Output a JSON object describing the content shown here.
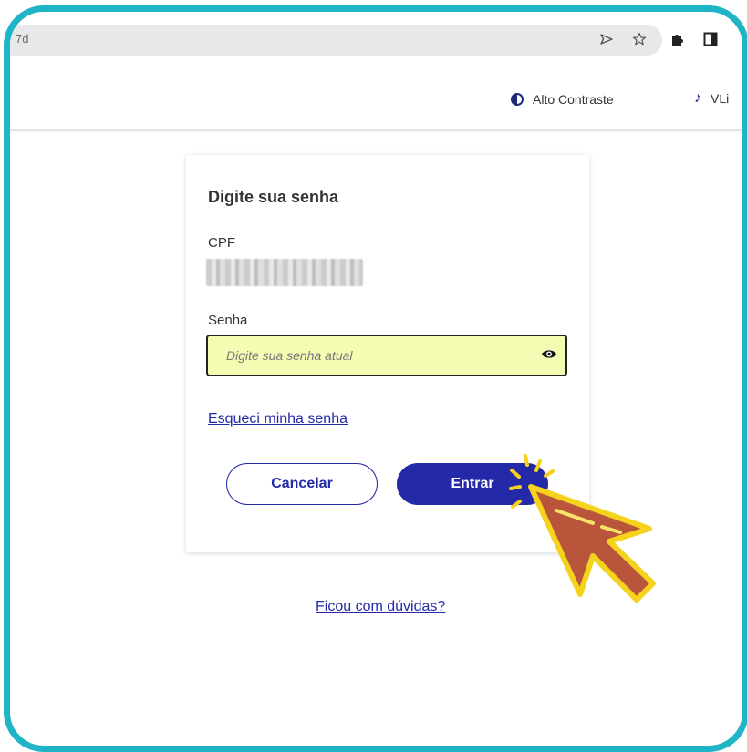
{
  "browser": {
    "url": "7d",
    "icons": [
      "send-icon",
      "star-icon",
      "puzzle-icon",
      "sidepanel-icon"
    ]
  },
  "nav": {
    "contrast_label": "Alto Contraste",
    "vlibras_label": "VLi"
  },
  "form": {
    "title": "Digite sua senha",
    "cpf_label": "CPF",
    "senha_label": "Senha",
    "senha_placeholder": "Digite sua senha atual",
    "forgot_link": "Esqueci minha senha",
    "cancel_label": "Cancelar",
    "enter_label": "Entrar"
  },
  "footer": {
    "doubts_link": "Ficou com dúvidas?"
  },
  "colors": {
    "frame": "#1fb5c6",
    "primary": "#2329a8",
    "input_bg": "#f4fbb3",
    "cursor_fill": "#b9553b",
    "cursor_outline": "#f5d21c"
  }
}
